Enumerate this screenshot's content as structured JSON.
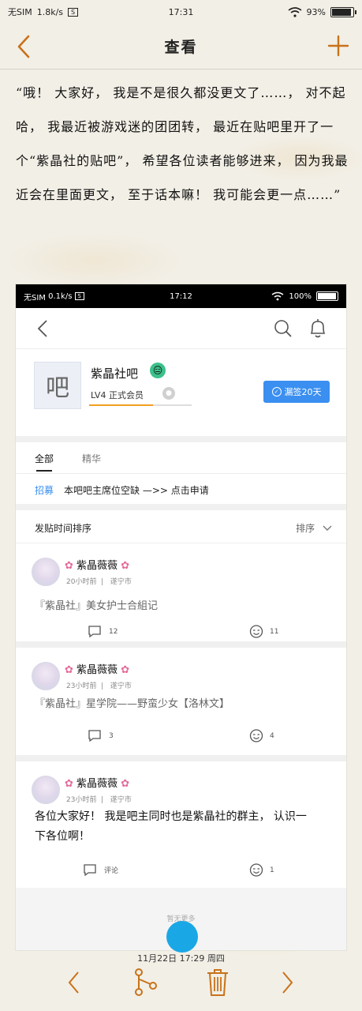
{
  "status_bar": {
    "carrier": "无SIM",
    "speed": "1.8k/s",
    "sim_icon": "S",
    "time": "17:31",
    "battery": "93%"
  },
  "title_bar": {
    "title": "查看",
    "back_icon": "chevron-left-icon",
    "add_icon": "plus-icon",
    "accent": "#c8721b"
  },
  "note": {
    "text": "“哦！ 大家好， 我是不是很久都没更文了……， 对不起哈， 我最近被游戏迷的团团转， 最近在贴吧里开了一个“紫晶社的贴吧”， 希望各位读者能够进来， 因为我最近会在里面更文， 至于话本嘛！ 我可能会更一点……”"
  },
  "embedded": {
    "status_bar": {
      "carrier": "无SIM",
      "speed": "0.1k/s",
      "sim_icon": "S",
      "time": "17:12",
      "battery": "100%"
    },
    "forum": {
      "avatar_char": "吧",
      "name": "紫晶社吧",
      "emoji": "😑",
      "level": "LV4 正式会员",
      "level_progress": 0.62,
      "sign_button": "漏签20天"
    },
    "tabs": [
      "全部",
      "精华"
    ],
    "recruit": {
      "tag": "招募",
      "text": "本吧吧主席位空缺 —>> 点击申请"
    },
    "sort": {
      "left": "发贴时间排序",
      "right": "排序"
    },
    "posts": [
      {
        "user": "紫晶薇薇",
        "flower": "✿",
        "time": "20小时前",
        "location": "遂宁市",
        "title": "『紫晶社』美女护士合組记",
        "comments": "12",
        "likes": "11"
      },
      {
        "user": "紫晶薇薇",
        "flower": "✿",
        "time": "23小时前",
        "location": "遂宁市",
        "title": "『紫晶社』星学院——野蛮少女【洛林文】",
        "comments": "3",
        "likes": "4"
      },
      {
        "user": "紫晶薇薇",
        "flower": "✿",
        "time": "23小时前",
        "location": "遂宁市",
        "body": "各位大家好！ 我是吧主同时也是紫晶社的群主， 认识一下各位啊！",
        "comments": "评论",
        "likes": "1"
      }
    ],
    "empty_text": "暂无更多"
  },
  "bottom": {
    "date": "11月22日 17:29 周四",
    "prev_icon": "chevron-left-icon",
    "share_icon": "share-icon",
    "delete_icon": "trash-icon",
    "next_icon": "chevron-right-icon"
  }
}
